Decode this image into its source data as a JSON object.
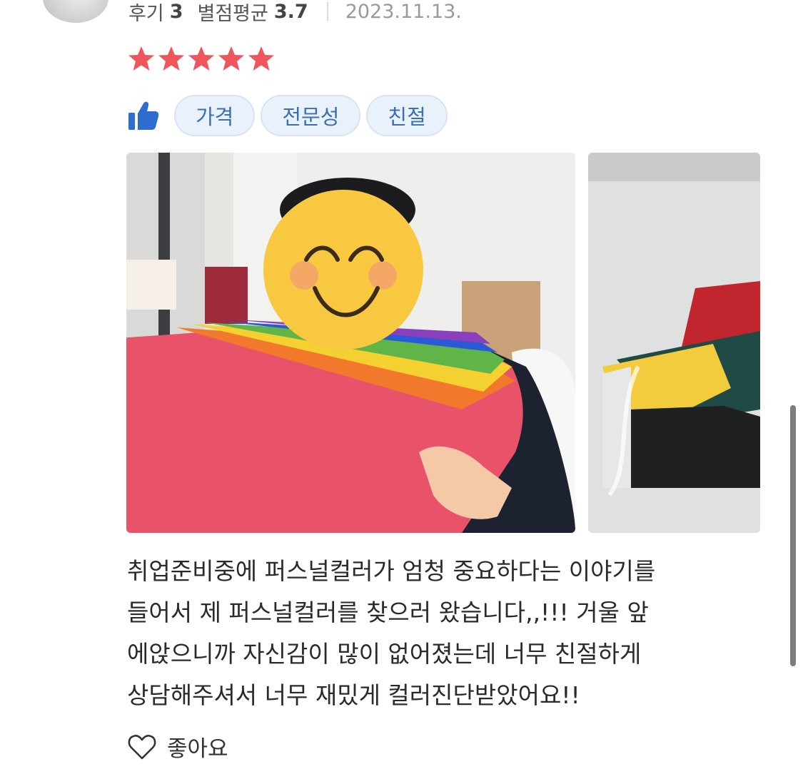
{
  "reviewer": {
    "review_count_label": "후기",
    "review_count": "3",
    "avg_rating_label": "별점평균",
    "avg_rating": "3.7",
    "date": "2023.11.13."
  },
  "rating": {
    "value": 5,
    "max": 5,
    "star_color": "#f0555c"
  },
  "tags": {
    "icon": "thumbs-up-icon",
    "items": [
      "가격",
      "전문성",
      "친절"
    ],
    "icon_color": "#2f6cd0"
  },
  "photos": [
    {
      "name": "review-photo-1",
      "description_icon": "image"
    },
    {
      "name": "review-photo-2",
      "description_icon": "image"
    }
  ],
  "review": {
    "lines": [
      "취업준비중에 퍼스널컬러가 엄청 중요하다는 이야기를",
      "들어서 제 퍼스널컬러를 찾으러 왔습니다,,!!! 거울 앞",
      "에앉으니까 자신감이 많이 없어졌는데 너무 친절하게",
      "상담해주셔서 너무 재밌게 컬러진단받았어요!!"
    ]
  },
  "like": {
    "icon": "heart-outline-icon",
    "label": "좋아요"
  }
}
